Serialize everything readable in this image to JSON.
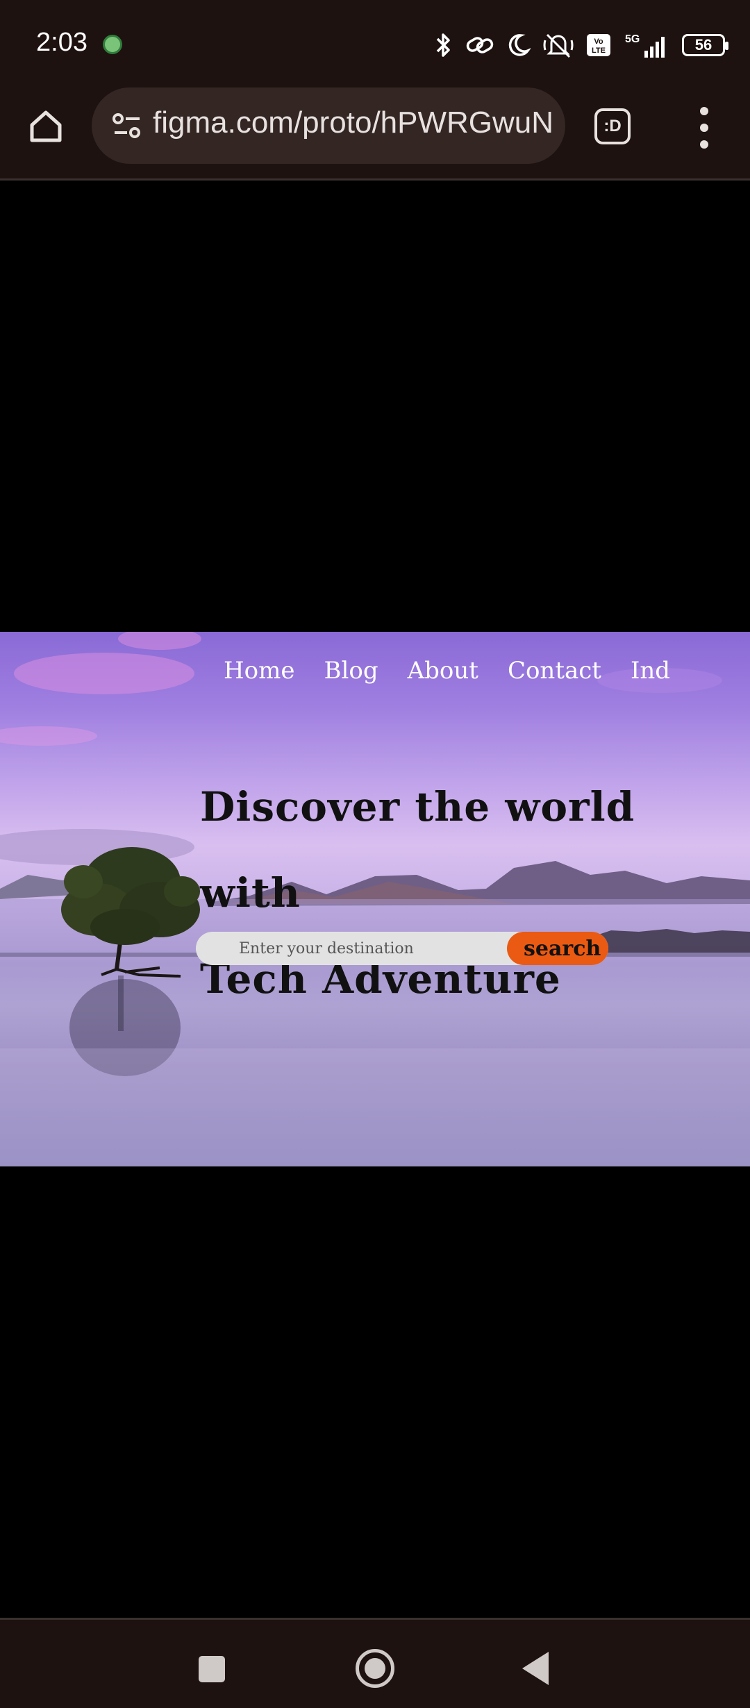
{
  "status_bar": {
    "time": "2:03",
    "battery": "56",
    "network": "5G",
    "icons": [
      "whatsapp-icon",
      "bluetooth-icon",
      "link-icon",
      "moon-icon",
      "vibrate-off-icon",
      "volte-icon",
      "signal-icon",
      "battery-icon"
    ]
  },
  "browser": {
    "url": "figma.com/proto/hPWRGwuN",
    "tabs_label": ":D"
  },
  "hero": {
    "nav": [
      "Home",
      "Blog",
      "About",
      "Contact",
      "Ind"
    ],
    "headline_line1": "Discover the world with",
    "headline_line2": "Tech Adventure",
    "search_placeholder": "Enter your destination",
    "search_button": "search"
  },
  "colors": {
    "accent": "#ea5a12",
    "system_bar": "#1d1210"
  }
}
